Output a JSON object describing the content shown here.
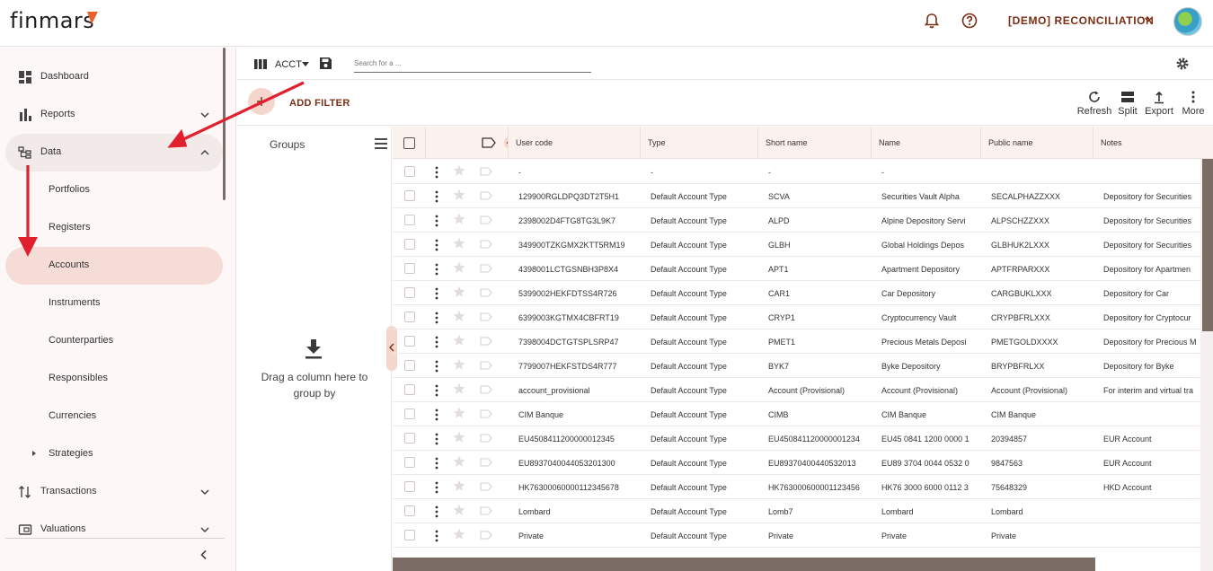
{
  "app": {
    "logo": "finmars",
    "workspace": "[DEMO] RECONCILIATION",
    "accent": "#e8602c",
    "brand_dark": "#7a2e14"
  },
  "sidebar": {
    "items": [
      {
        "label": "Dashboard",
        "icon": "dashboard-icon"
      },
      {
        "label": "Reports",
        "icon": "bar-chart-icon"
      },
      {
        "label": "Data",
        "icon": "tree-icon"
      },
      {
        "label": "Portfolios"
      },
      {
        "label": "Registers"
      },
      {
        "label": "Accounts"
      },
      {
        "label": "Instruments"
      },
      {
        "label": "Counterparties"
      },
      {
        "label": "Responsibles"
      },
      {
        "label": "Currencies"
      },
      {
        "label": "Strategies"
      },
      {
        "label": "Transactions",
        "icon": "transfer-icon"
      },
      {
        "label": "Valuations",
        "icon": "wallet-icon"
      }
    ]
  },
  "toolbar": {
    "layout_label": "ACCT",
    "search_placeholder": "Search for a ..."
  },
  "filterbar": {
    "add_filter": "ADD FILTER",
    "actions": [
      "Refresh",
      "Split",
      "Export",
      "More"
    ]
  },
  "groups": {
    "title": "Groups",
    "drop_text": "Drag a column here to group by"
  },
  "table": {
    "columns": [
      "User code",
      "Type",
      "Short name",
      "Name",
      "Public name",
      "Notes"
    ],
    "rows": [
      [
        "-",
        "-",
        "-",
        "-",
        "",
        ""
      ],
      [
        "129900RGLDPQ3DT2T5H1",
        "Default Account Type",
        "SCVA",
        "Securities Vault Alpha",
        "SECALPHAZZXXX",
        "Depository for Securities"
      ],
      [
        "2398002D4FTG8TG3L9K7",
        "Default Account Type",
        "ALPD",
        "Alpine Depository Servi",
        "ALPSCHZZXXX",
        "Depository for Securities"
      ],
      [
        "349900TZKGMX2KTT5RM19",
        "Default Account Type",
        "GLBH",
        "Global Holdings Depos",
        "GLBHUK2LXXX",
        "Depository for Securities"
      ],
      [
        "4398001LCTGSNBH3P8X4",
        "Default Account Type",
        "APT1",
        "Apartment Depository",
        "APTFRPARXXX",
        "Depository for Apartmen"
      ],
      [
        "5399002HEKFDTSS4R726",
        "Default Account Type",
        "CAR1",
        "Car Depository",
        "CARGBUKLXXX",
        "Depository for Car"
      ],
      [
        "6399003KGTMX4CBFRT19",
        "Default Account Type",
        "CRYP1",
        "Cryptocurrency Vault",
        "CRYPBFRLXXX",
        "Depository for Cryptocur"
      ],
      [
        "7398004DCTGTSPLSRP47",
        "Default Account Type",
        "PMET1",
        "Precious Metals Deposi",
        "PMETGOLDXXXX",
        "Depository for Precious M"
      ],
      [
        "7799007HEKFSTDS4R777",
        "Default Account Type",
        "BYK7",
        "Byke Depository",
        "BRYPBFRLXX",
        "Depository for Byke"
      ],
      [
        "account_provisional",
        "Default Account Type",
        "Account (Provisional)",
        "Account (Provisional)",
        "Account (Provisional)",
        "For interim and virtual tra"
      ],
      [
        "CIM Banque",
        "Default Account Type",
        "CIMB",
        "CIM Banque",
        "CIM Banque",
        ""
      ],
      [
        "EU4508411200000012345",
        "Default Account Type",
        "EU450841120000001234",
        "EU45 0841 1200 0000 1",
        "20394857",
        "EUR Account"
      ],
      [
        "EU8937040044053201300",
        "Default Account Type",
        "EU89370400440532013",
        "EU89 3704 0044 0532 0",
        "9847563",
        "EUR Account"
      ],
      [
        "HK76300060000112345678",
        "Default Account Type",
        "HK763000600001123456",
        "HK76 3000 6000 0112 3",
        "75648329",
        "HKD Account"
      ],
      [
        "Lombard",
        "Default Account Type",
        "Lomb7",
        "Lombard",
        "Lombard",
        ""
      ],
      [
        "Private",
        "Default Account Type",
        "Private",
        "Private",
        "Private",
        ""
      ]
    ]
  }
}
